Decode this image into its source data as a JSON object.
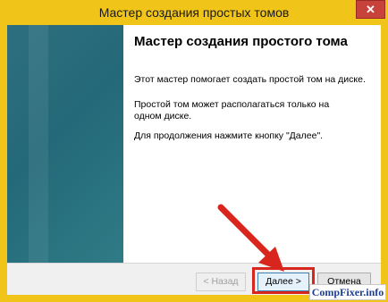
{
  "window": {
    "title": "Мастер создания простых томов",
    "close_label": "✕"
  },
  "content": {
    "heading": "Мастер создания простого тома",
    "paragraphs": [
      "Этот мастер помогает создать простой том на диске.",
      "Простой том может располагаться только на одном диске.",
      "Для продолжения нажмите кнопку \"Далее\"."
    ]
  },
  "buttons": {
    "back": "< Назад",
    "next": "Далее >",
    "cancel": "Отмена"
  },
  "watermark": "CompFixer.info",
  "colors": {
    "frame": "#f0c419",
    "highlight": "#d8261f",
    "sidebar": "#246979"
  }
}
